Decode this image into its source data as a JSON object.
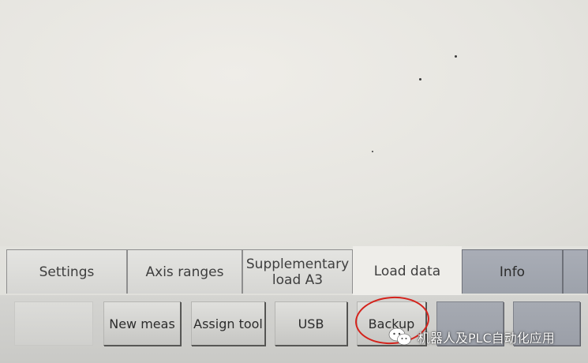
{
  "tabs": [
    {
      "label": "Settings",
      "state": "inactive"
    },
    {
      "label": "Axis ranges",
      "state": "inactive"
    },
    {
      "label": "Supplementary load A3",
      "state": "inactive"
    },
    {
      "label": "Load data",
      "state": "active"
    },
    {
      "label": "Info",
      "state": "inactive-dark"
    }
  ],
  "buttons": {
    "blank_1": "",
    "new_meas": "New meas",
    "assign_tool": "Assign tool",
    "usb": "USB",
    "backup": "Backup",
    "blank_2": "",
    "blank_3": ""
  },
  "annotation": {
    "highlight_color": "#d4231c",
    "highlighted": "Backup"
  },
  "watermark": {
    "text": "机器人及PLC自动化应用",
    "icon": "wechat-icon"
  },
  "colors": {
    "active_tab": "#eeede9",
    "dark_tab": "#a3a7b0",
    "button_face": "#d3d3d0"
  }
}
